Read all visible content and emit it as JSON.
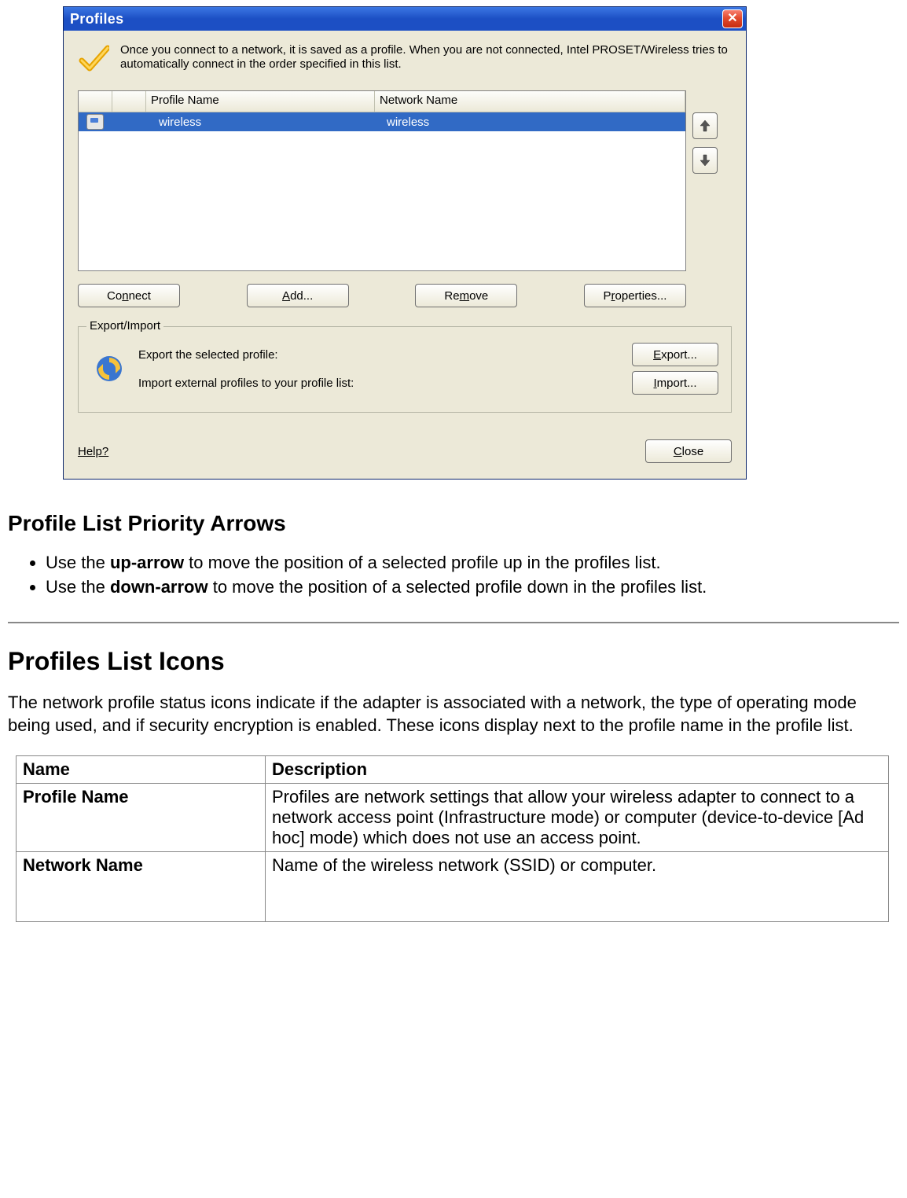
{
  "dialog": {
    "title": "Profiles",
    "intro": "Once you connect to a network, it is saved as a profile. When you are not connected, Intel PROSET/Wireless tries to automatically connect in the order specified in this list.",
    "columns": {
      "profile": "Profile Name",
      "network": "Network Name"
    },
    "row": {
      "profile": "wireless",
      "network": "wireless"
    },
    "buttons": {
      "connect_pre": "Co",
      "connect_u": "n",
      "connect_post": "nect",
      "add_u": "A",
      "add_post": "dd...",
      "remove_pre": "Re",
      "remove_u": "m",
      "remove_post": "ove",
      "properties_pre": "P",
      "properties_u": "r",
      "properties_post": "operties..."
    },
    "group": {
      "title": "Export/Import",
      "line_export": "Export the selected profile:",
      "line_import": "Import external profiles to your profile list:",
      "btn_export_u": "E",
      "btn_export_post": "xport...",
      "btn_import_u": "I",
      "btn_import_post": "mport..."
    },
    "help": "Help?",
    "close_u": "C",
    "close_post": "lose"
  },
  "doc": {
    "h_arrows": "Profile List Priority Arrows",
    "b1_pre": "Use the ",
    "b1_bold": "up-arrow",
    "b1_post": " to move the position of a selected profile up in the profiles list.",
    "b2_pre": "Use the ",
    "b2_bold": "down-arrow",
    "b2_post": " to move the position of a selected profile down in the profiles list.",
    "h_icons": "Profiles List Icons",
    "p_icons": "The network profile status icons indicate if the adapter is associated with a network, the type of operating mode being used, and if security encryption is enabled. These icons display next to the profile name in the profile list.",
    "table": {
      "h_name": "Name",
      "h_desc": "Description",
      "r1_name": "Profile Name",
      "r1_desc": "Profiles are network settings that allow your wireless adapter to connect to a network access point (Infrastructure mode) or computer (device-to-device [Ad hoc] mode) which does not use an access point.",
      "r2_name": "Network Name",
      "r2_desc": "Name of the wireless network (SSID) or computer."
    }
  }
}
